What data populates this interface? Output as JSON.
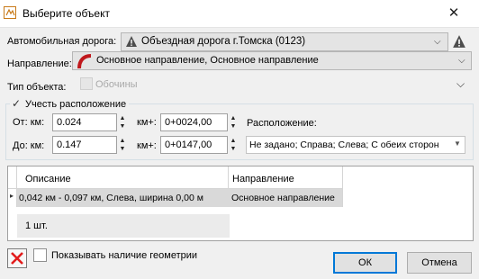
{
  "window": {
    "title": "Выберите объект",
    "close_glyph": "✕"
  },
  "road": {
    "label": "Автомобильная дорога:",
    "value": "Объездная дорога г.Томска (0123)",
    "warning_icon": "warning-triangle-icon"
  },
  "direction": {
    "label": "Направление:",
    "value": "Основное направление, Основное направление"
  },
  "object_type": {
    "label": "Тип объекта:",
    "value": "Обочины"
  },
  "location_group": {
    "checkbox_label": "Учесть расположение",
    "checked": true,
    "from_km_label": "От: км:",
    "from_km_value": "0.024",
    "from_kmplus_label": "км+:",
    "from_kmplus_value": "0+0024,00",
    "to_km_label": "До: км:",
    "to_km_value": "0.147",
    "to_kmplus_label": "км+:",
    "to_kmplus_value": "0+0147,00",
    "position_label": "Расположение:",
    "position_value": "Не задано; Справа; Слева; С обеих сторон"
  },
  "table": {
    "columns": [
      "Описание",
      "Направление"
    ],
    "rows": [
      {
        "description": "0,042 км - 0,097 км, Слева, ширина 0,00 м",
        "direction": "Основное направление"
      }
    ],
    "count": "1 шт."
  },
  "footer": {
    "show_geometry_label": "Показывать наличие геометрии",
    "ok_label": "ОК",
    "cancel_label": "Отмена"
  },
  "colors": {
    "accent": "#0078d7",
    "title_bg": "#ffffff",
    "window_bg": "#f0f0f0",
    "row_selected": "#d9d9d9"
  }
}
